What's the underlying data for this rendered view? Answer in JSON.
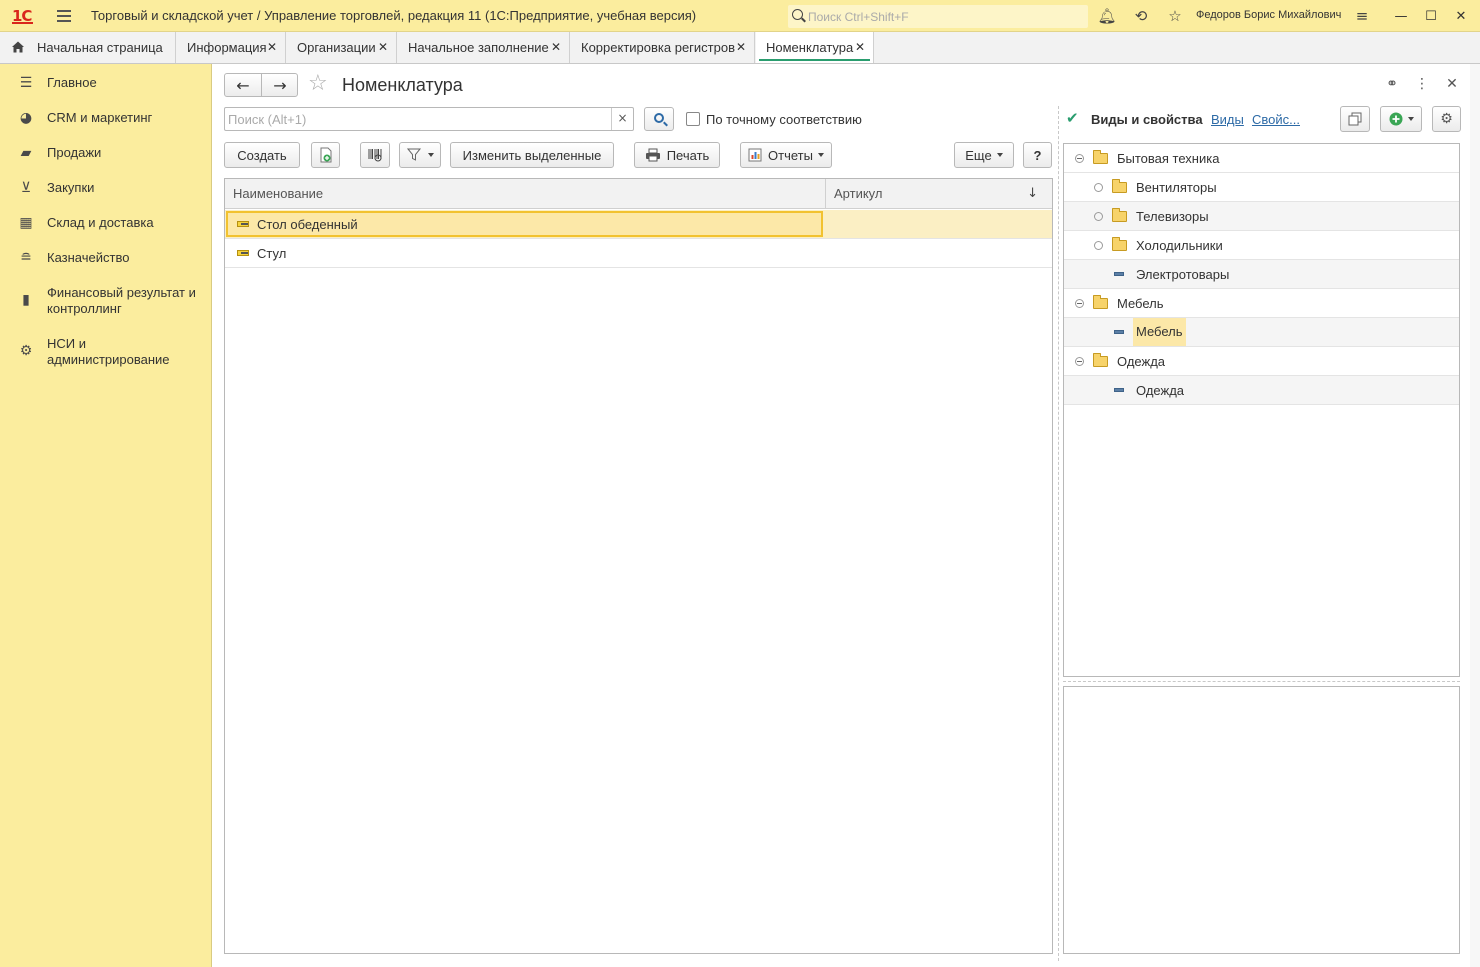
{
  "titlebar": {
    "logo": "1С",
    "app_title": "Торговый и складской учет / Управление торговлей, редакция 11  (1С:Предприятие, учебная версия)",
    "search_placeholder": "Поиск Ctrl+Shift+F",
    "user_name": "Федоров Борис Михайлович",
    "icons": [
      "bell-icon",
      "history-icon",
      "star-icon",
      "settings-lines-icon"
    ],
    "window_buttons": {
      "minimize": "—",
      "maximize": "☐",
      "close": "✕"
    }
  },
  "tabs": [
    {
      "label": "Начальная страница",
      "closable": false
    },
    {
      "label": "Информация",
      "closable": true
    },
    {
      "label": "Организации",
      "closable": true
    },
    {
      "label": "Начальное заполнение",
      "closable": true
    },
    {
      "label": "Корректировка регистров",
      "closable": true
    },
    {
      "label": "Номенклатура",
      "closable": true,
      "active": true
    }
  ],
  "tab_close_glyph": "✕",
  "sidebar": {
    "items": [
      {
        "label": "Главное",
        "icon": "menu-lines-icon"
      },
      {
        "label": "CRM и маркетинг",
        "icon": "pie-chart-icon"
      },
      {
        "label": "Продажи",
        "icon": "shopping-bag-icon"
      },
      {
        "label": "Закупки",
        "icon": "cart-icon"
      },
      {
        "label": "Склад и доставка",
        "icon": "warehouse-grid-icon"
      },
      {
        "label": "Казначейство",
        "icon": "coins-icon"
      },
      {
        "label": "Финансовый результат и контроллинг",
        "icon": "bar-chart-icon"
      },
      {
        "label": "НСИ и администрирование",
        "icon": "gear-icon"
      }
    ]
  },
  "page": {
    "title": "Номенклатура",
    "nav_back": "←",
    "nav_forward": "→",
    "favorite_glyph": "☆",
    "header_icons": {
      "link": "🔗",
      "more": "⋮",
      "close": "✕"
    }
  },
  "search": {
    "placeholder": "Поиск (Alt+1)",
    "value": "",
    "clear_glyph": "×",
    "exact_match_label": "По точному соответствию",
    "exact_match_checked": false
  },
  "toolbar": {
    "create": "Создать",
    "change_selected": "Изменить выделенные",
    "print": "Печать",
    "reports": "Отчеты",
    "more": "Еще",
    "help": "?"
  },
  "list": {
    "columns": [
      "Наименование",
      "Артикул"
    ],
    "sort_glyph": "↓",
    "rows": [
      {
        "name": "Стол обеденный",
        "article": "",
        "selected": true
      },
      {
        "name": "Стул",
        "article": "",
        "selected": false
      }
    ]
  },
  "right_panel": {
    "checkbox_glyph": "✔",
    "title": "Виды и свойства",
    "link_kinds": "Виды",
    "link_props": "Свойс...",
    "tree": [
      {
        "label": "Бытовая техника",
        "level": 0,
        "type": "folder",
        "expanded": true
      },
      {
        "label": "Вентиляторы",
        "level": 1,
        "type": "folder",
        "expanded": false
      },
      {
        "label": "Телевизоры",
        "level": 1,
        "type": "folder",
        "expanded": false
      },
      {
        "label": "Холодильники",
        "level": 1,
        "type": "folder",
        "expanded": false
      },
      {
        "label": "Электротовары",
        "level": 1,
        "type": "leaf"
      },
      {
        "label": "Мебель",
        "level": 0,
        "type": "folder",
        "expanded": true
      },
      {
        "label": "Мебель",
        "level": 1,
        "type": "leaf",
        "highlighted": true
      },
      {
        "label": "Одежда",
        "level": 0,
        "type": "folder",
        "expanded": true
      },
      {
        "label": "Одежда",
        "level": 1,
        "type": "leaf"
      }
    ]
  },
  "colors": {
    "sidebar_bg": "#fbed9e",
    "selection": "#fce8a8",
    "accent_green": "#2a9d6f",
    "link_blue": "#2d6aa6"
  }
}
